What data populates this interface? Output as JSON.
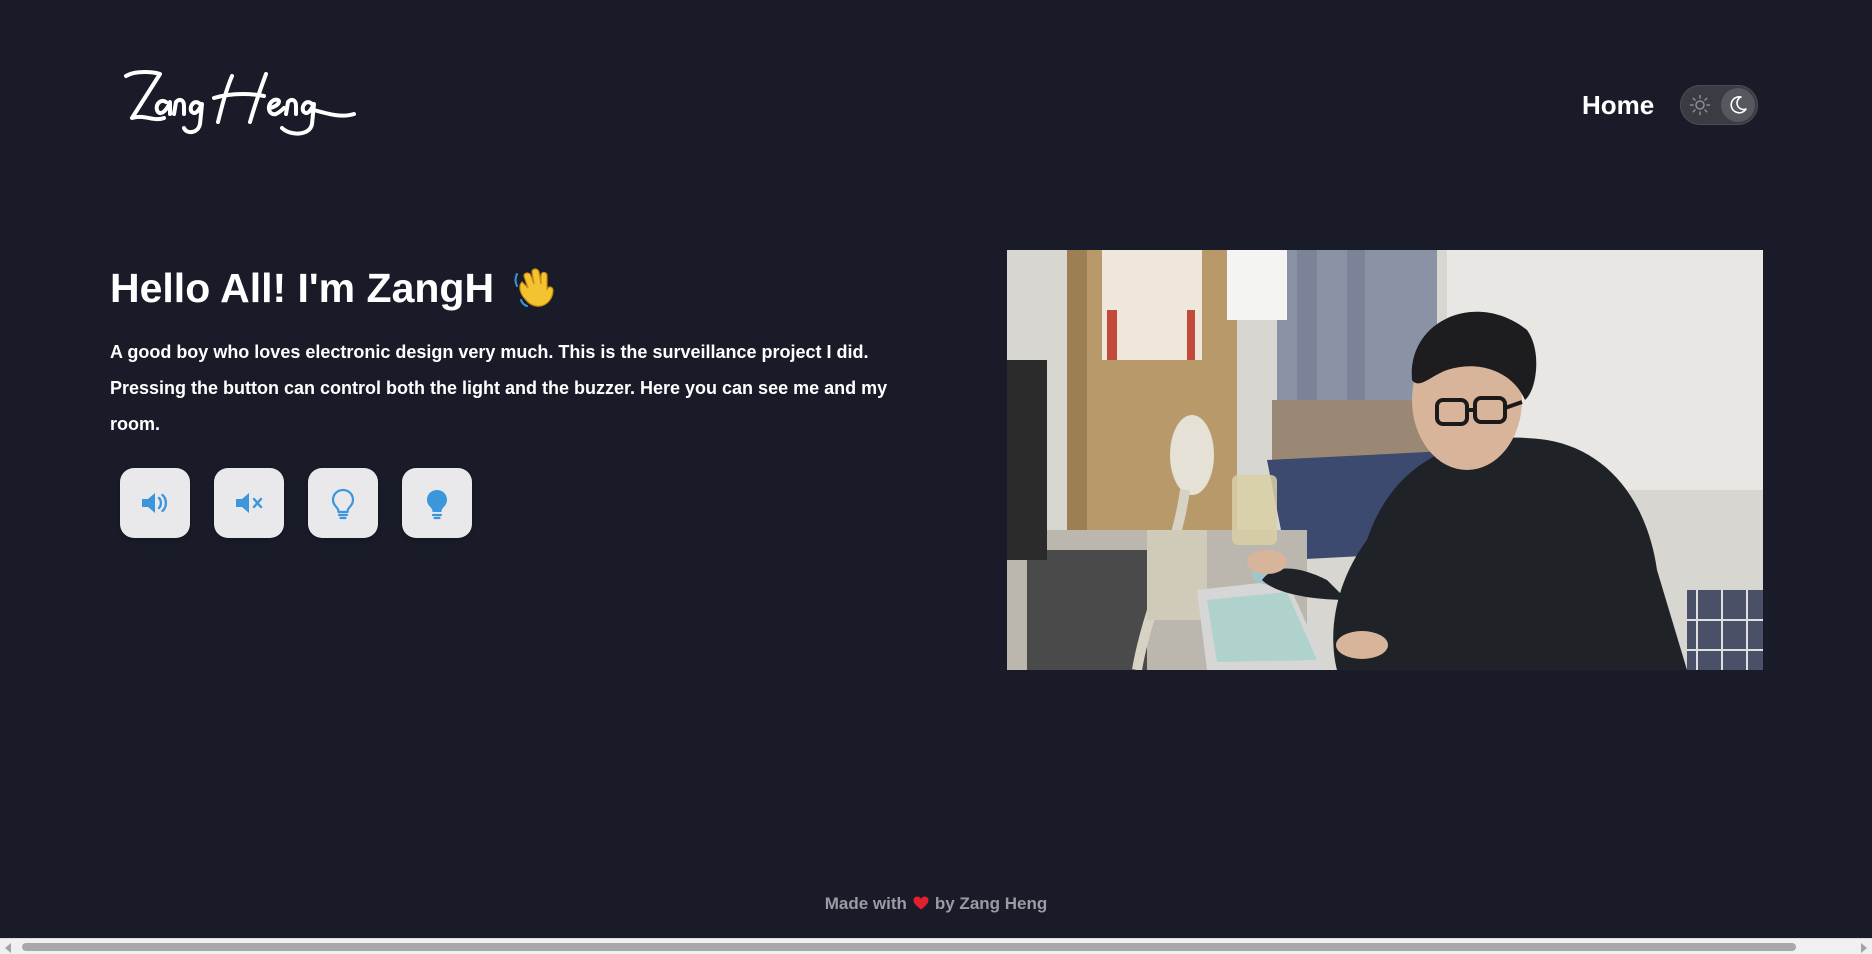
{
  "header": {
    "logo_text": "Zang Heng",
    "nav_home_label": "Home",
    "theme_toggle_state": "dark"
  },
  "hero": {
    "title": "Hello All! I'm ZangH",
    "title_emoji": "waving-hand",
    "description": "A good boy who loves electronic design very much. This is the surveillance project I did. Pressing the button can control both the light and the buzzer. Here you can see me and my room."
  },
  "controls": [
    {
      "icon": "volume-up-icon",
      "action": "buzzer-on"
    },
    {
      "icon": "volume-mute-icon",
      "action": "buzzer-off"
    },
    {
      "icon": "lightbulb-outline-icon",
      "action": "light-off"
    },
    {
      "icon": "lightbulb-filled-icon",
      "action": "light-on"
    }
  ],
  "camera": {
    "description": "live camera feed"
  },
  "footer": {
    "prefix": "Made with",
    "suffix": "by Zang Heng",
    "heart_icon": "heart-icon"
  },
  "colors": {
    "background": "#191c28",
    "button_bg": "#e9e9ec",
    "icon_accent": "#3c96dc",
    "footer_text": "#9a9ca4",
    "heart": "#e0202c"
  }
}
